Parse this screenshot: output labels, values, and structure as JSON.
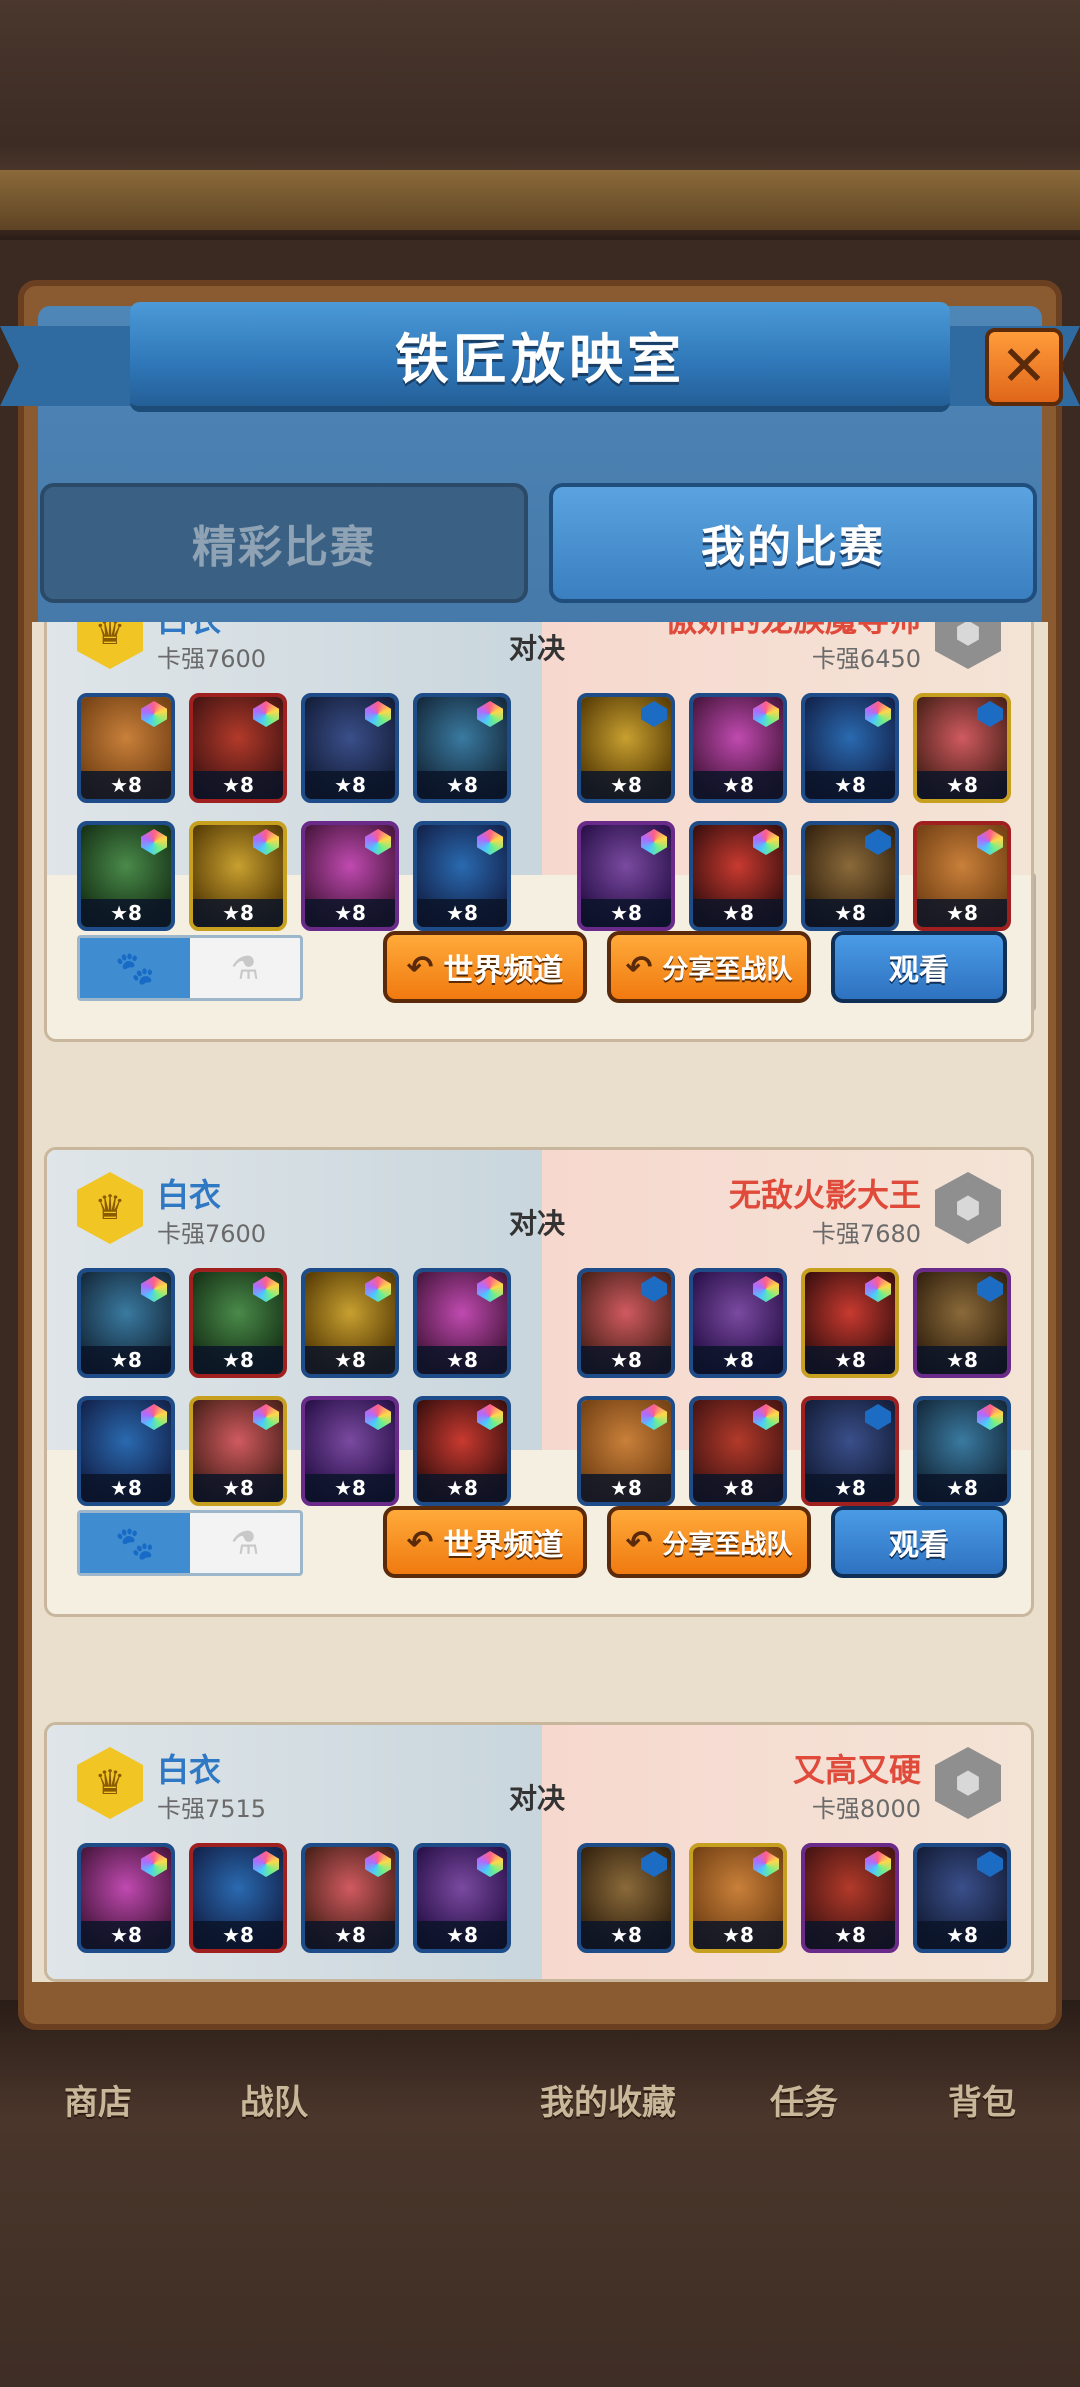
{
  "title": "铁匠放映室",
  "close_label": "✕",
  "tabs": [
    {
      "label": "精彩比赛",
      "active": false
    },
    {
      "label": "我的比赛",
      "active": true
    }
  ],
  "vs_label": "对决",
  "buttons": {
    "world_channel": "世界频道",
    "share_team": "分享至战队",
    "watch": "观看"
  },
  "matches": [
    {
      "left": {
        "name": "白衣",
        "power": "卡强7600"
      },
      "right": {
        "name": "傲娇的龙族魔导师",
        "power": "卡强6450"
      },
      "left_heroes": [
        "★8",
        "★8",
        "★8",
        "★8",
        "★8",
        "★8",
        "★8",
        "★8"
      ],
      "right_heroes": [
        "★8",
        "★8",
        "★8",
        "★8",
        "★8",
        "★8",
        "★8",
        "★8"
      ]
    },
    {
      "left": {
        "name": "白衣",
        "power": "卡强7600"
      },
      "right": {
        "name": "无敌火影大王",
        "power": "卡强7680"
      },
      "left_heroes": [
        "★8",
        "★8",
        "★8",
        "★8",
        "★8",
        "★8",
        "★8",
        "★8"
      ],
      "right_heroes": [
        "★8",
        "★8",
        "★8",
        "★8",
        "★8",
        "★8",
        "★8",
        "★8"
      ]
    },
    {
      "left": {
        "name": "白衣",
        "power": "卡强7515"
      },
      "right": {
        "name": "又高又硬",
        "power": "卡强8000"
      },
      "left_heroes": [
        "★8",
        "★8",
        "★8",
        "★8"
      ],
      "right_heroes": [
        "★8",
        "★8",
        "★8",
        "★8"
      ]
    }
  ],
  "bottom_nav": [
    "商店",
    "战队",
    "我的收藏",
    "任务",
    "背包"
  ],
  "colors": {
    "ribbon": "#2f77b8",
    "orange_button": "#f07a10",
    "blue_button": "#2e72c0",
    "left_player_name": "#2f78c4",
    "right_player_name": "#e04a3a"
  }
}
